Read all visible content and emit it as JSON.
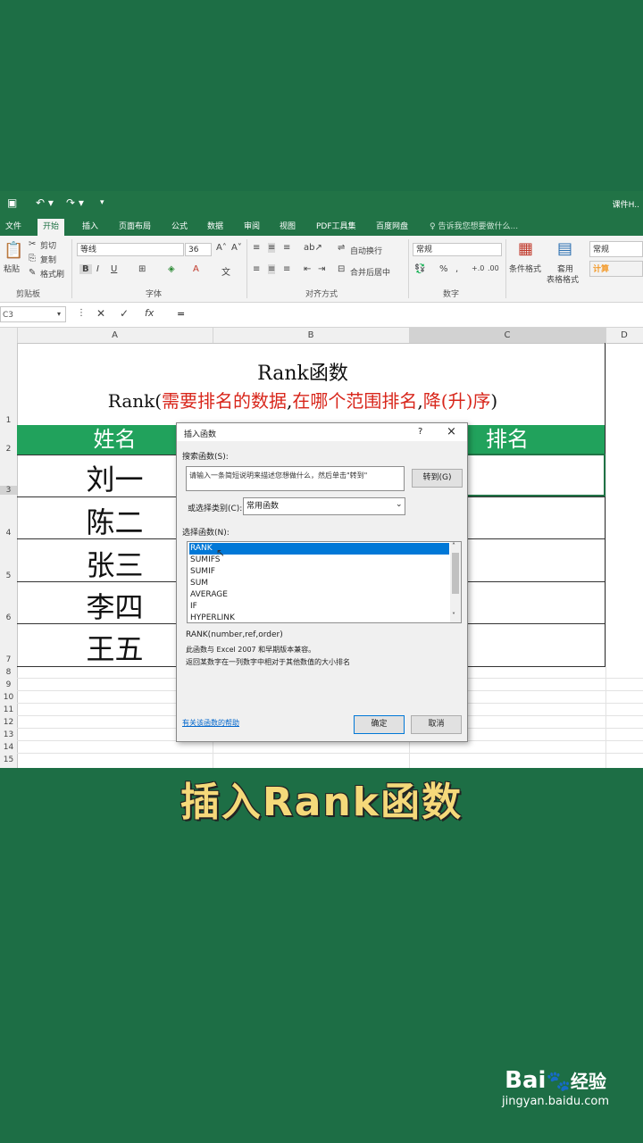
{
  "titlebar": {
    "doc_title": "课件H.."
  },
  "tabs": [
    "文件",
    "开始",
    "插入",
    "页面布局",
    "公式",
    "数据",
    "审阅",
    "视图",
    "PDF工具集",
    "百度网盘"
  ],
  "tell_me": "告诉我您想要做什么...",
  "ribbon": {
    "paste": "粘贴",
    "cut": "剪切",
    "copy": "复制",
    "format_painter": "格式刷",
    "clipboard_group": "剪贴板",
    "font_name": "等线",
    "font_size": "36",
    "font_group": "字体",
    "wrap_text": "自动换行",
    "merge_center": "合并后居中",
    "align_group": "对齐方式",
    "number_format": "常规",
    "number_group": "数字",
    "cond_format": "条件格式",
    "table_format_1": "套用",
    "table_format_2": "表格格式",
    "style_normal": "常规",
    "style_calc": "计算"
  },
  "formula": {
    "name_box": "C3",
    "content": "="
  },
  "columns": [
    "A",
    "B",
    "C",
    "D"
  ],
  "rows": [
    "1",
    "2",
    "3",
    "4",
    "5",
    "6",
    "7",
    "8",
    "9",
    "10",
    "11",
    "12",
    "13",
    "14",
    "15"
  ],
  "sheet": {
    "title": "Rank函数",
    "syntax_prefix": "Rank(",
    "syntax_arg1": "需要排名的数据",
    "syntax_comma1": ",",
    "syntax_arg2": "在哪个范围排名",
    "syntax_comma2": ",",
    "syntax_arg3": "降(升)序",
    "syntax_suffix": ")",
    "header_name": "姓名",
    "header_rank": "排名",
    "names": [
      "刘一",
      "陈二",
      "张三",
      "李四",
      "王五"
    ]
  },
  "dialog": {
    "title": "插入函数",
    "help_q": "?",
    "close": "×",
    "search_label": "搜索函数(S):",
    "search_placeholder": "请输入一条简短说明来描述您想做什么，然后单击\"转到\"",
    "go_button": "转到(G)",
    "category_label": "或选择类别(C):",
    "category_value": "常用函数",
    "select_label": "选择函数(N):",
    "functions": [
      "RANK",
      "SUMIFS",
      "SUMIF",
      "SUM",
      "AVERAGE",
      "IF",
      "HYPERLINK"
    ],
    "signature": "RANK(number,ref,order)",
    "desc1": "此函数与 Excel 2007 和早期版本兼容。",
    "desc2": "返回某数字在一列数字中相对于其他数值的大小排名",
    "help_link": "有关该函数的帮助",
    "ok": "确定",
    "cancel": "取消"
  },
  "caption": "插入Rank函数",
  "watermark": {
    "brand": "Bai",
    "brand2": "经验",
    "url": "jingyan.baidu.com"
  }
}
